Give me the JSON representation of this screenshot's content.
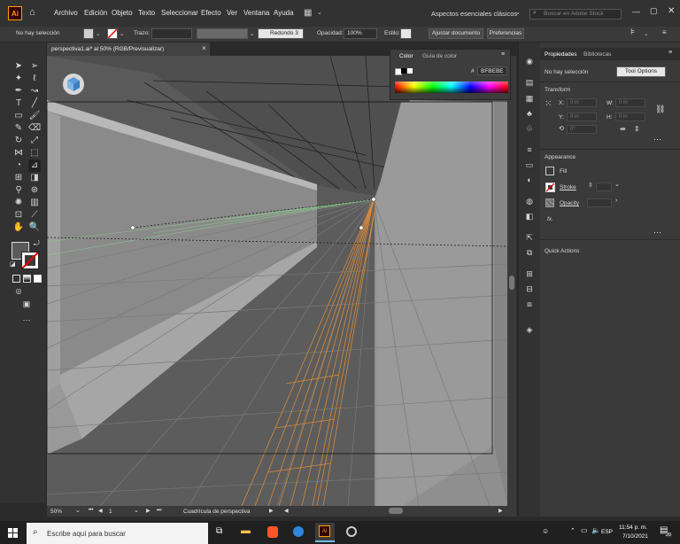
{
  "menubar": {
    "app_logo": "Ai",
    "items": [
      "Archivo",
      "Edición",
      "Objeto",
      "Texto",
      "Seleccionar",
      "Efecto",
      "Ver",
      "Ventana",
      "Ayuda"
    ],
    "workspace": "Aspectos esenciales clásicos",
    "search_placeholder": "Buscar en Adobe Stock"
  },
  "controlbar": {
    "selection": "No hay selección",
    "stroke_label": "Trazo:",
    "brush": "Redondo 3 ...",
    "opacity_label": "Opacidad:",
    "opacity_value": "100%",
    "style_label": "Estilo:",
    "adjust_button": "Ajustar documento",
    "prefs_button": "Preferencias"
  },
  "document": {
    "tab_title": "perspectiva1.ai* al 50% (RGB/Previsualizar)",
    "tab_close": "×",
    "zoom": "50%",
    "artboard": "1",
    "status": "Cuadrícula de perspectiva"
  },
  "color_panel": {
    "tabs": [
      "Color",
      "Guía de color"
    ],
    "hex_symbol": "#",
    "hex": "BFBEBE"
  },
  "properties": {
    "tabs": [
      "Propiedades",
      "Bibliotecas"
    ],
    "no_selection": "No hay selección",
    "tool_options": "Tool Options",
    "transform_heading": "Transform",
    "x_label": "X:",
    "y_label": "Y:",
    "w_label": "W:",
    "h_label": "H:",
    "field_placeholder": "0 in",
    "angle_placeholder": "0°",
    "appearance_heading": "Appearance",
    "fill": "Fill",
    "stroke": "Stroke",
    "opacity": "Opacity",
    "fx": "fx.",
    "quick_actions_heading": "Quick Actions"
  },
  "taskbar": {
    "search_placeholder": "Escribe aquí para buscar",
    "time": "11:54 p. m.",
    "date": "7/10/2021",
    "language": "ESP",
    "notification_count": "20"
  },
  "colors": {
    "app_bg": "#323232",
    "canvas": "#5a5a5a",
    "accent_orange": "#d8893a",
    "accent_green": "#8cd28c",
    "hex_value": "#BFBEBE"
  }
}
